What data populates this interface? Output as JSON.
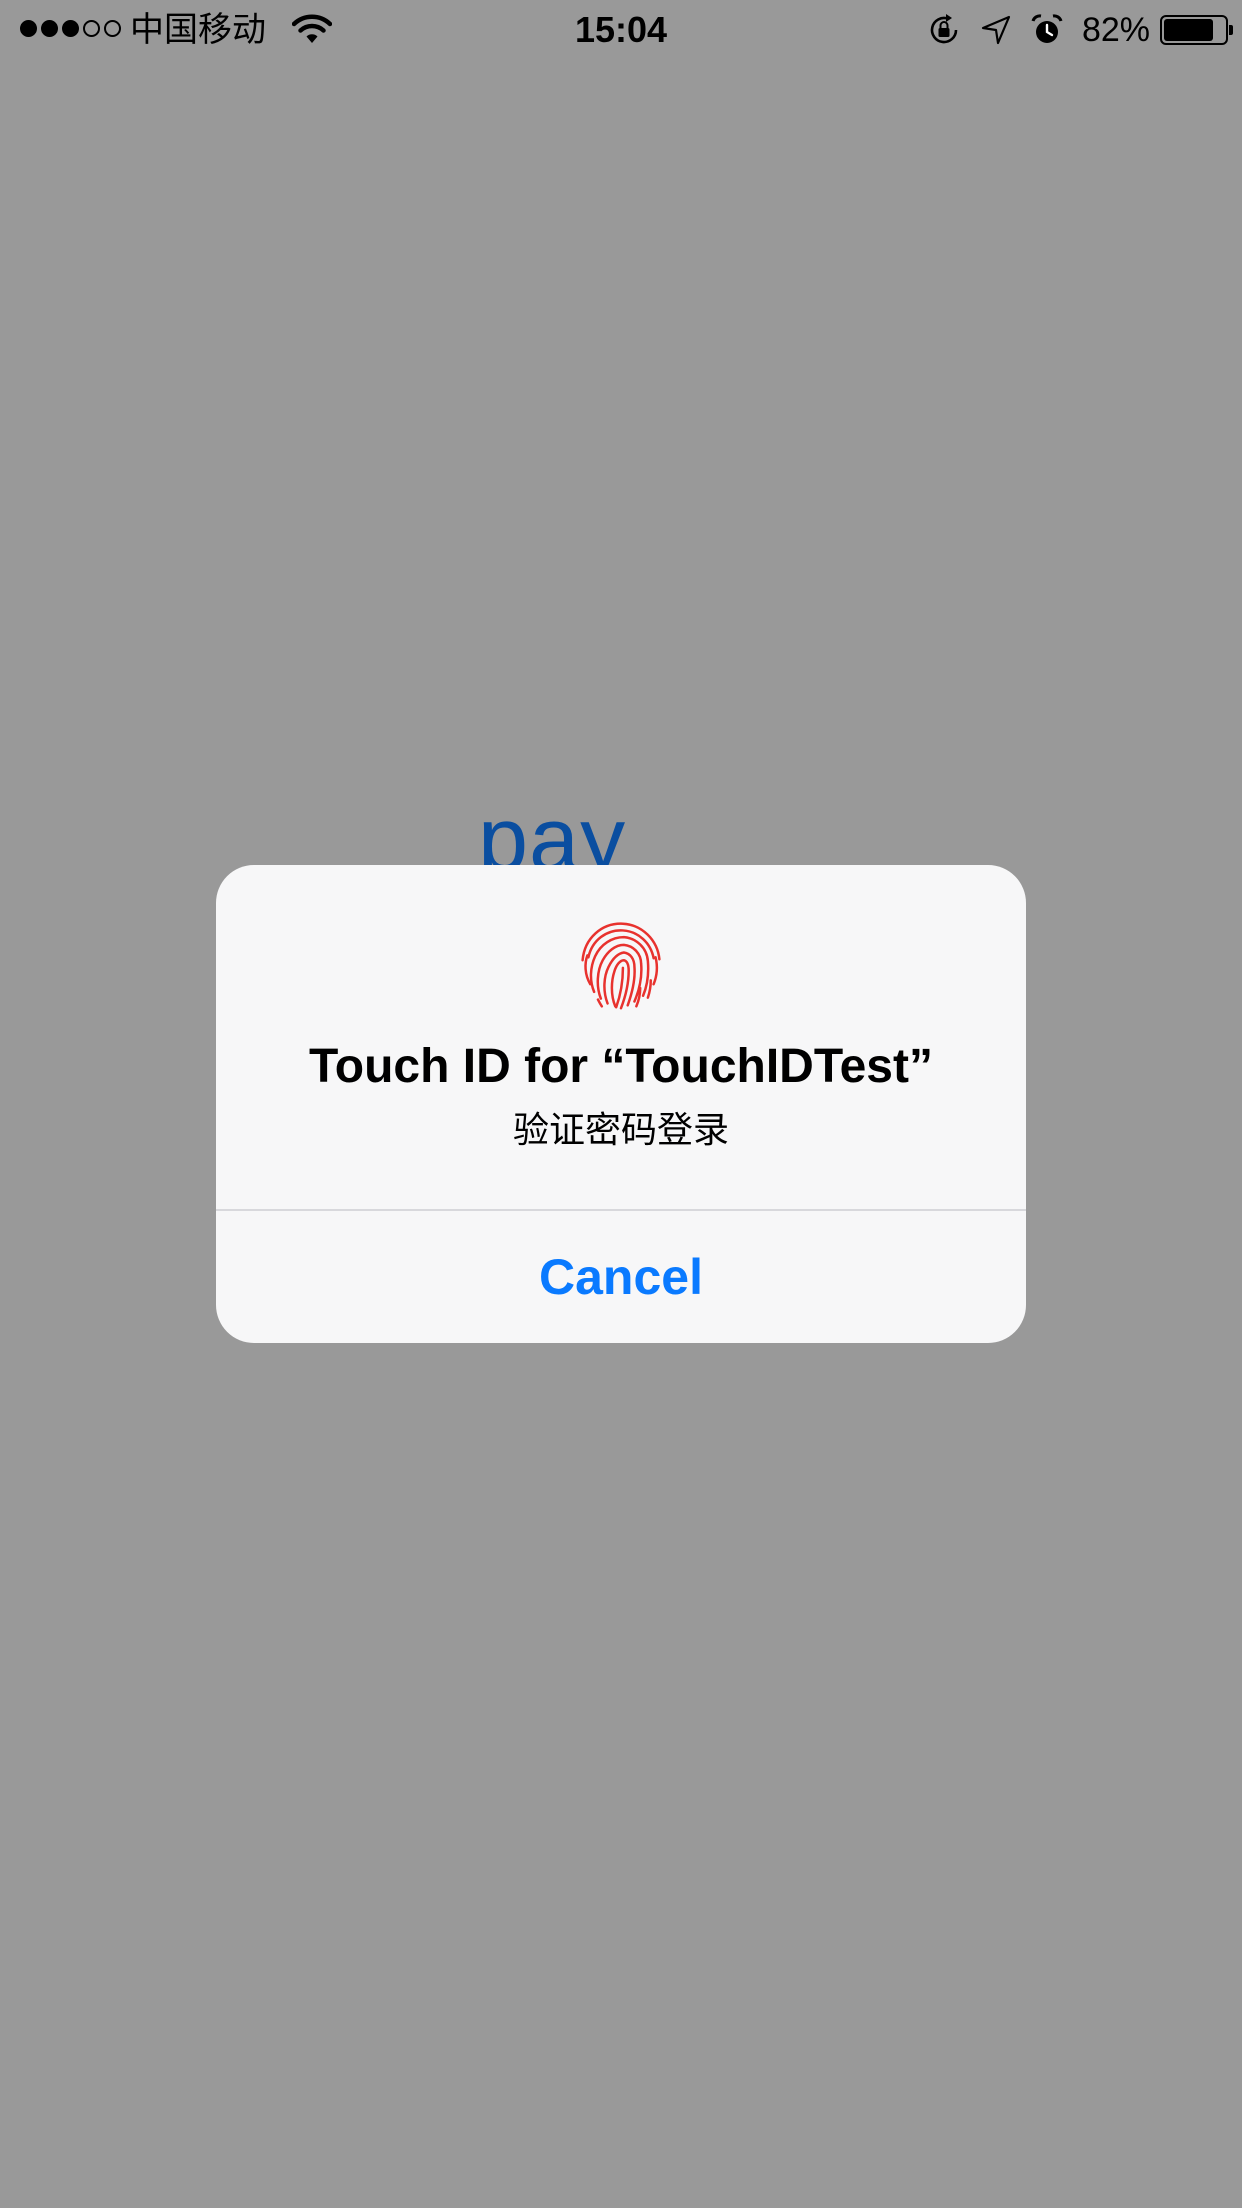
{
  "status_bar": {
    "carrier": "中国移动",
    "time": "15:04",
    "battery_percent": "82%",
    "battery_level": 0.82,
    "signal_bars_filled": 3,
    "signal_bars_total": 5,
    "icons": [
      "wifi-icon",
      "orientation-lock-icon",
      "location-arrow-icon",
      "alarm-icon",
      "battery-icon"
    ]
  },
  "background": {
    "visible_text": "pay",
    "text_color": "#0a4ea0",
    "dim_color": "#999999"
  },
  "alert": {
    "icon": "fingerprint-icon",
    "icon_color": "#e8322e",
    "title": "Touch ID for “TouchIDTest”",
    "message": "验证密码登录",
    "cancel_label": "Cancel",
    "cancel_color": "#0a7aff"
  }
}
